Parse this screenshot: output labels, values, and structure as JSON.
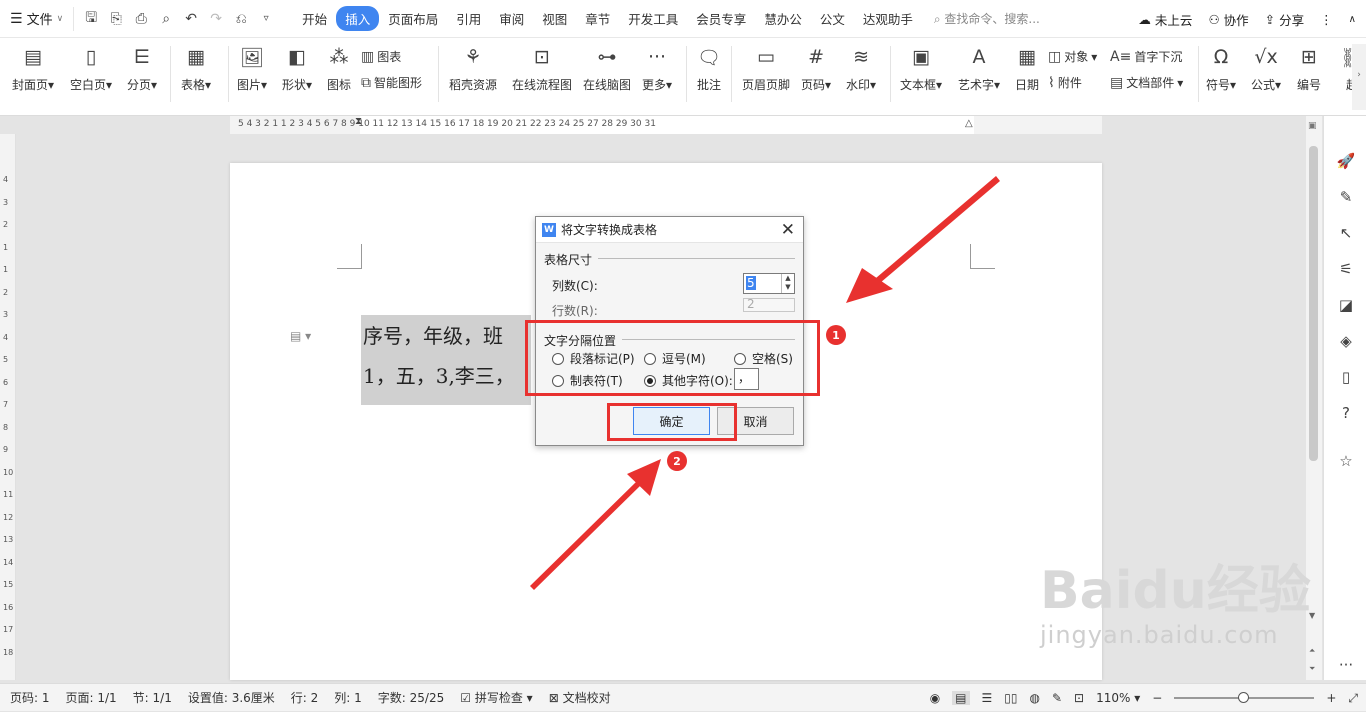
{
  "menubar": {
    "file_label": "文件",
    "tabs": [
      {
        "label": "开始"
      },
      {
        "label": "插入"
      },
      {
        "label": "页面布局"
      },
      {
        "label": "引用"
      },
      {
        "label": "审阅"
      },
      {
        "label": "视图"
      },
      {
        "label": "章节"
      },
      {
        "label": "开发工具"
      },
      {
        "label": "会员专享"
      },
      {
        "label": "慧办公"
      },
      {
        "label": "公文"
      },
      {
        "label": "达观助手"
      }
    ],
    "active_tab": "插入",
    "search_placeholder": "查找命令、搜索...",
    "cloud_label": "未上云",
    "collab_label": "协作",
    "share_label": "分享"
  },
  "ribbon": {
    "cover": "封面页",
    "blank": "空白页",
    "pagebreak": "分页",
    "table": "表格",
    "picture": "图片",
    "shape": "形状",
    "icon": "图标",
    "chart": "图表",
    "smartart": "智能图形",
    "daoke": "稻壳资源",
    "flowchart": "在线流程图",
    "mindmap": "在线脑图",
    "more": "更多",
    "comment": "批注",
    "headerfooter": "页眉页脚",
    "pagenum": "页码",
    "watermark": "水印",
    "textbox": "文本框",
    "wordart": "艺术字",
    "date": "日期",
    "object": "对象",
    "attachment": "附件",
    "dropcap": "首字下沉",
    "docparts": "文档部件",
    "symbol": "符号",
    "formula": "公式",
    "numbering": "编号",
    "hyperlink_partial": "超"
  },
  "hruler_ticks": "5  4  3  2  1     1  2  3  4  5  6  7  8  9  10 11 12 13 14 15 16 17 18 19 20 21 22 23 24 25    27 28 29 30 31",
  "vruler_ticks": [
    "4",
    "3",
    "2",
    "1",
    "",
    "1",
    "2",
    "3",
    "4",
    "5",
    "6",
    "7",
    "8",
    "9",
    "10",
    "11",
    "12",
    "13",
    "14",
    "15",
    "16",
    "17",
    "18"
  ],
  "document": {
    "line1": "序号，年级，班",
    "line2": "1，五，3,李三，"
  },
  "dialog": {
    "title": "将文字转换成表格",
    "size_group": "表格尺寸",
    "cols_label": "列数(C):",
    "cols_value": "5",
    "rows_label": "行数(R):",
    "rows_value": "2",
    "sep_group": "文字分隔位置",
    "opt_paragraph": "段落标记(P)",
    "opt_comma": "逗号(M)",
    "opt_space": "空格(S)",
    "opt_tab": "制表符(T)",
    "opt_other": "其他字符(O):",
    "other_value": "，",
    "selected_option": "其他字符(O):",
    "ok": "确定",
    "cancel": "取消"
  },
  "annotations": {
    "badge1": "1",
    "badge2": "2",
    "highlight_color": "#e8312f"
  },
  "statusbar": {
    "pages_code": "页码: 1",
    "page": "页面: 1/1",
    "section": "节: 1/1",
    "setting": "设置值: 3.6厘米",
    "row": "行: 2",
    "col": "列: 1",
    "wordcount": "字数: 25/25",
    "spellcheck": "拼写检查",
    "proof": "文档校对",
    "zoom": "110%"
  },
  "watermark": {
    "brand": "Baidu经验",
    "url": "jingyan.baidu.com"
  },
  "colors": {
    "accent": "#3f85f0",
    "red": "#e8312f"
  }
}
